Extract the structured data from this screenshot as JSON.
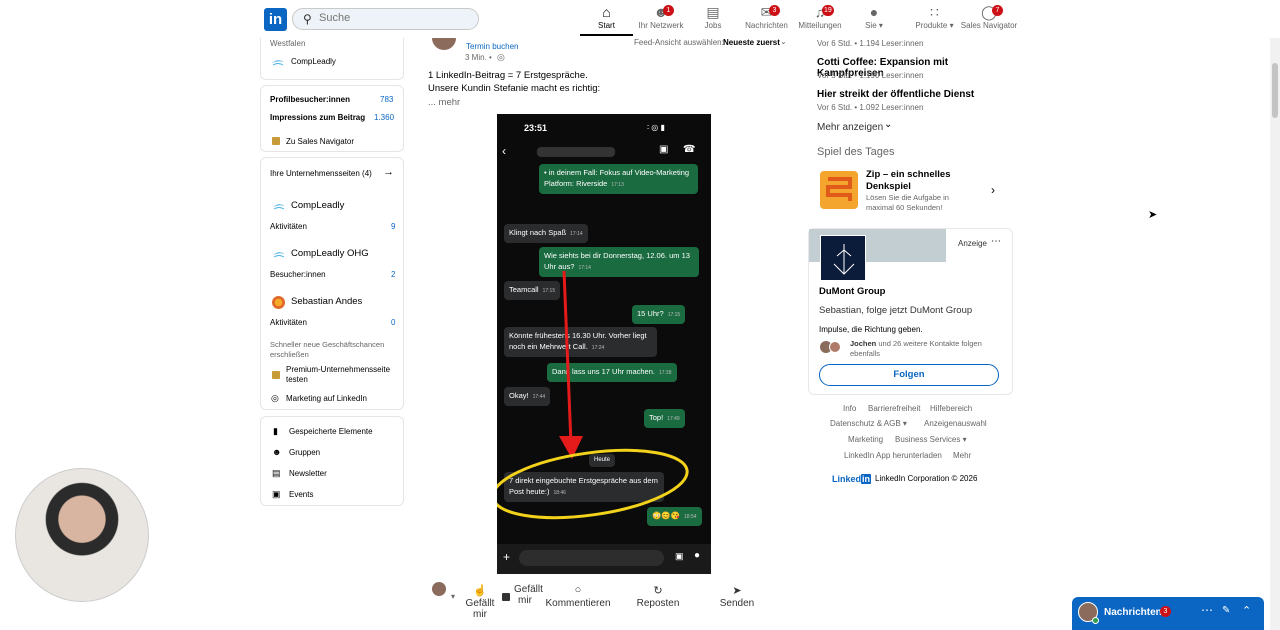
{
  "nav": {
    "search_placeholder": "Suche",
    "items": [
      {
        "label": "Start",
        "icon": "home-icon"
      },
      {
        "label": "Ihr Netzwerk",
        "icon": "network-icon",
        "badge": "1"
      },
      {
        "label": "Jobs",
        "icon": "jobs-icon"
      },
      {
        "label": "Nachrichten",
        "icon": "messaging-icon",
        "badge": "3"
      },
      {
        "label": "Mitteilungen",
        "icon": "bell-icon",
        "badge": "19"
      },
      {
        "label": "Sie ▾",
        "icon": "profile-avatar"
      },
      {
        "label": "Produkte ▾",
        "icon": "grid-icon"
      },
      {
        "label": "Sales Navigator",
        "icon": "sales-nav-icon",
        "badge": "7"
      }
    ]
  },
  "left": {
    "location": "Westfalen",
    "company": "CompLeadly",
    "profile_visitors_label": "Profilbesucher:innen",
    "profile_visitors_value": "783",
    "impressions_label": "Impressions zum Beitrag",
    "impressions_value": "1.360",
    "sales_nav_link": "Zu Sales Navigator",
    "pages_header": "Ihre Unternehmensseiten (4)",
    "pages": [
      {
        "name": "CompLeadly",
        "metric": "Aktivitäten",
        "value": "9"
      },
      {
        "name": "CompLeadly OHG",
        "metric": "Besucher:innen",
        "value": "2"
      },
      {
        "name": "Sebastian Andes",
        "metric": "Aktivitäten",
        "value": "0"
      }
    ],
    "promo_text": "Schneller neue Geschäftschancen erschließen",
    "premium_link": "Premium-Unternehmensseite testen",
    "marketing_link": "Marketing auf LinkedIn",
    "shortcuts": [
      "Gespeicherte Elemente",
      "Gruppen",
      "Newsletter",
      "Events"
    ]
  },
  "post": {
    "feed_sort": "Feed-Ansicht auswählen:",
    "feed_sort_value": "Neueste zuerst",
    "author_sub": "Termin buchen",
    "time": "3 Min. •",
    "line1": "1 LinkedIn-Beitrag = 7 Erstgespräche.",
    "line2": "Unsere Kundin Stefanie macht es richtig:",
    "more": "... mehr",
    "phone_time": "23:51",
    "chat": [
      {
        "dir": "out",
        "text": "• in deinem Fall: Fokus auf Video-Marketing Platform: Riverside",
        "ts": "17:13"
      },
      {
        "dir": "in",
        "text": "Klingt nach Spaß",
        "ts": "17:14"
      },
      {
        "dir": "out",
        "text": "Wie siehts bei dir Donnerstag, 12.06. um 13 Uhr aus?",
        "ts": "17:14"
      },
      {
        "dir": "in",
        "text": "Teamcall",
        "ts": "17:15"
      },
      {
        "dir": "out",
        "text": "15 Uhr?",
        "ts": "17:15"
      },
      {
        "dir": "in",
        "text": "Könnte frühestens 16.30 Uhr. Vorher liegt noch ein Mehrwert Call.",
        "ts": "17:24"
      },
      {
        "dir": "out",
        "text": "Dann lass uns 17 Uhr machen.",
        "ts": "17:38"
      },
      {
        "dir": "in",
        "text": "Okay!",
        "ts": "17:44"
      },
      {
        "dir": "out",
        "text": "Top!",
        "ts": "17:49"
      },
      {
        "dir": "in",
        "text": "7 direkt eingebuchte Erstgespräche aus dem Post heute:)",
        "ts": "18:46"
      },
      {
        "dir": "out",
        "text": "😳😊😘",
        "ts": "18:54"
      }
    ],
    "day_label": "Heute",
    "actions": [
      "Gefällt mir",
      "Kommentieren",
      "Reposten",
      "Senden"
    ]
  },
  "right": {
    "news": [
      {
        "title": "",
        "meta": "Vor 6 Std. • 1.194 Leser:innen"
      },
      {
        "title": "Cotti Coffee: Expansion mit Kampfpreisen",
        "meta": "Vor 5 Std. • 1.190 Leser:innen"
      },
      {
        "title": "Hier streikt der öffentliche Dienst",
        "meta": "Vor 6 Std. • 1.092 Leser:innen"
      }
    ],
    "show_more": "Mehr anzeigen",
    "game_header": "Spiel des Tages",
    "game_title": "Zip – ein schnelles Denkspiel",
    "game_sub": "Lösen Sie die Aufgabe in maximal 60 Sekunden!",
    "ad_label": "Anzeige",
    "ad_company": "DuMont Group",
    "ad_text": "Sebastian, folge jetzt DuMont Group",
    "ad_tagline": "Impulse, die Richtung geben.",
    "ad_contacts_name": "Jochen",
    "ad_contacts": "und 26 weitere Kontakte folgen ebenfalls",
    "follow": "Folgen",
    "footer_links": [
      "Info",
      "Barrierefreiheit",
      "Hilfebereich",
      "Datenschutz & AGB ▾",
      "Anzeigenauswahl",
      "Marketing",
      "Business Services ▾",
      "LinkedIn App herunterladen",
      "Mehr"
    ],
    "copyright": "LinkedIn Corporation © 2026"
  },
  "messaging": {
    "label": "Nachrichten",
    "badge": "3"
  }
}
